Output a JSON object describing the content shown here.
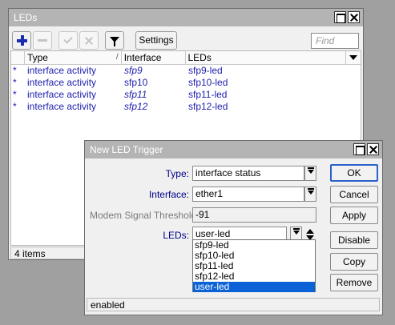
{
  "leds_window": {
    "title": "LEDs",
    "toolbar": {
      "settings_label": "Settings",
      "find_placeholder": "Find"
    },
    "table": {
      "columns": [
        "Type",
        "Interface",
        "LEDs"
      ],
      "rows": [
        {
          "flag": "*",
          "type": "interface activity",
          "interface": "sfp9",
          "leds": "sfp9-led"
        },
        {
          "flag": "*",
          "type": "interface activity",
          "interface": "sfp10",
          "leds": "sfp10-led"
        },
        {
          "flag": "*",
          "type": "interface activity",
          "interface": "sfp11",
          "leds": "sfp11-led"
        },
        {
          "flag": "*",
          "type": "interface activity",
          "interface": "sfp12",
          "leds": "sfp12-led"
        }
      ]
    },
    "status": "4 items"
  },
  "dialog": {
    "title": "New LED Trigger",
    "type_label": "Type:",
    "type_value": "interface status",
    "interface_label": "Interface:",
    "interface_value": "ether1",
    "threshold_label": "Modem Signal Threshold:",
    "threshold_value": "-91",
    "leds_label": "LEDs:",
    "leds_value": "user-led",
    "leds_options": [
      "sfp9-led",
      "sfp10-led",
      "sfp11-led",
      "sfp12-led",
      "user-led"
    ],
    "buttons": {
      "ok": "OK",
      "cancel": "Cancel",
      "apply": "Apply",
      "disable": "Disable",
      "copy": "Copy",
      "remove": "Remove"
    },
    "status": "enabled"
  },
  "colors": {
    "label_blue": "#00008a",
    "row_text": "#2020b0",
    "selection": "#0a62d6",
    "titlebar": "#b4b4b4"
  }
}
